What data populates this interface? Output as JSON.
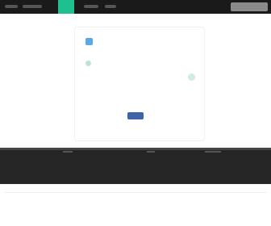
{
  "window": {
    "title": ""
  },
  "topbar": {
    "accent_color": "#1fbf8f",
    "right_button_label": ""
  },
  "dialog": {
    "option_1_label": "",
    "option_1_sublabel": "",
    "option_2_label": "",
    "option_3_label": "",
    "primary_button_label": ""
  },
  "colors": {
    "primary": "#3f63a8",
    "option_blue": "#5aa9e6",
    "option_green": "#bfe3cf"
  },
  "icons": {
    "option_1": "checkbox-icon",
    "option_2": "circle-icon",
    "side": "status-dot-icon"
  }
}
